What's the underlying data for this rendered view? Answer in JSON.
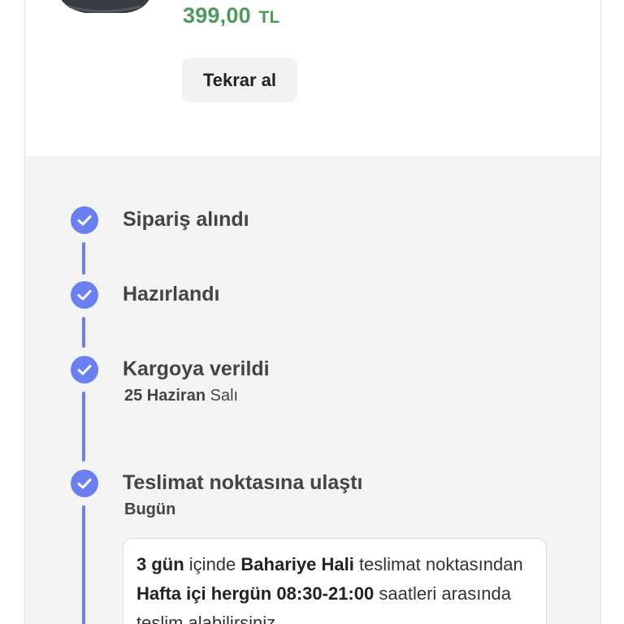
{
  "product": {
    "price_value": "399,00",
    "price_currency": "TL",
    "rebuy_label": "Tekrar al"
  },
  "colors": {
    "price": "#4a9a5a",
    "accent": "#6a7ff0",
    "tracking_bg": "#f4f4f4"
  },
  "tracking": {
    "steps": [
      {
        "title": "Sipariş alındı",
        "icon": "check-circle-icon"
      },
      {
        "title": "Hazırlandı",
        "icon": "check-circle-icon"
      },
      {
        "title": "Kargoya verildi",
        "date_bold": "25 Haziran",
        "date_rest": "Salı",
        "icon": "check-circle-icon"
      },
      {
        "title": "Teslimat noktasına ulaştı",
        "date_bold": "Bugün",
        "icon": "check-circle-icon"
      }
    ],
    "info": {
      "days": "3 gün",
      "t1": "içinde",
      "point": "Bahariye Hali",
      "t2": "teslimat noktasından",
      "hours": "Hafta içi hergün 08:30-21:00",
      "t3": "saatleri arasında teslim alabilirsiniz."
    }
  }
}
